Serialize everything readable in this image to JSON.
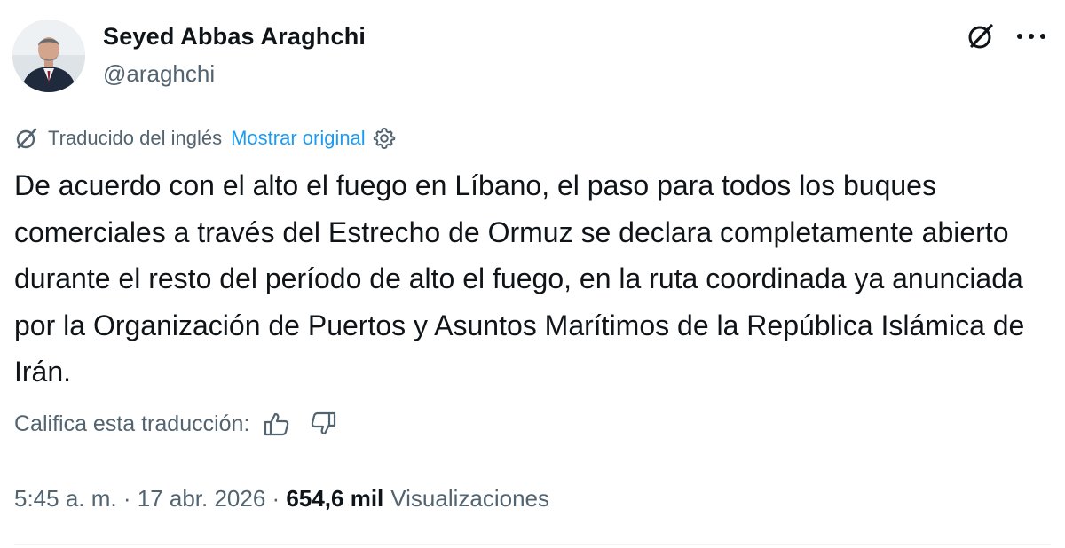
{
  "author": {
    "name": "Seyed Abbas Araghchi",
    "handle": "@araghchi"
  },
  "header_icons": {
    "grok": "grok-slash-icon",
    "more": "more-horizontal-icon"
  },
  "translation": {
    "translated_from": "Traducido del inglés",
    "show_original": "Mostrar original",
    "settings_icon": "gear-icon"
  },
  "tweet": {
    "text": "De acuerdo con el alto el fuego en Líbano, el paso para todos los buques comerciales a través del Estrecho de Ormuz se declara completamente abierto durante el resto del período de alto el fuego, en la ruta coordinada ya anunciada por la Organización de Puertos y Asuntos Marítimos de la República Islámica de Irán."
  },
  "rating": {
    "label": "Califica esta traducción:",
    "up_icon": "thumbs-up-icon",
    "down_icon": "thumbs-down-icon"
  },
  "meta": {
    "time": "5:45 a. m.",
    "sep1": " · ",
    "date": "17 abr. 2026",
    "sep2": " · ",
    "views_count": "654,6 mil",
    "views_label": "Visualizaciones"
  },
  "colors": {
    "text_primary": "#0f1419",
    "text_secondary": "#536471",
    "link": "#1d9bf0",
    "divider": "#eff3f4"
  }
}
